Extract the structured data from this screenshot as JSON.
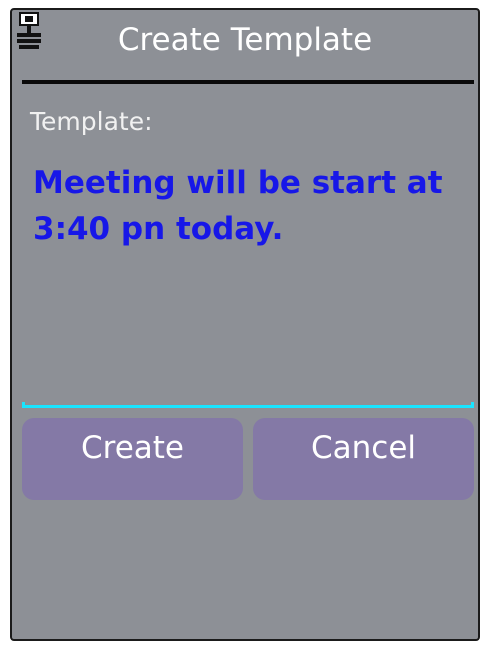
{
  "dialog": {
    "title": "Create Template",
    "title_icon": "sim-card-phone-icon"
  },
  "form": {
    "label": "Template:",
    "template_text": "Meeting will be start at\n3:40 pn today."
  },
  "buttons": {
    "create_label": "Create",
    "cancel_label": "Cancel"
  },
  "colors": {
    "background": "#8d9096",
    "text_input": "#1717e8",
    "button": "#8479a6",
    "focus_underline": "#19e4ff"
  }
}
